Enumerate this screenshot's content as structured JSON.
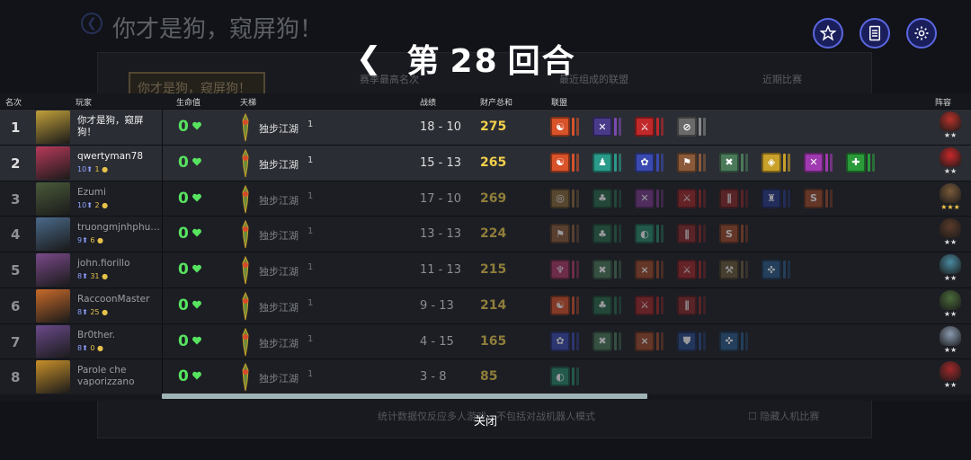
{
  "background": {
    "title": "你才是狗，窥屏狗！",
    "frame_text": "你才是狗，窥屏狗！",
    "tabs": [
      "赛季最高名次",
      "最近组成的联盟",
      "近期比赛"
    ],
    "footer_note": "统计数据仅反应多人游戏，不包括对战机器人模式",
    "footer_checkbox": "隐藏人机比赛"
  },
  "header": {
    "round_prefix": "第",
    "round_number": "28",
    "round_suffix": "回合",
    "back_icon": "chevron-left-icon"
  },
  "top_buttons": [
    {
      "icon": "star-icon"
    },
    {
      "icon": "document-icon"
    },
    {
      "icon": "gear-icon"
    }
  ],
  "columns": {
    "rank": "名次",
    "player": "玩家",
    "health": "生命值",
    "ladder": "天梯",
    "record": "战绩",
    "wealth": "财产总和",
    "alliances": "联盟",
    "lineup": "阵容"
  },
  "players": [
    {
      "rank": "1",
      "name": "你才是狗，窥屏狗！",
      "stats_a": "",
      "stats_b": "",
      "hp": "0",
      "ladder": "独步江湖",
      "ladder_rank": "1",
      "record": "18 - 10",
      "wealth": "275",
      "avatar_color": "#c2a03a",
      "lineup_color": "#b8322a",
      "stars": "★★",
      "alliances": [
        {
          "color": "#d8522a",
          "glyph": "☯",
          "bar": "#d8522a"
        },
        {
          "color": "#4a3a8a",
          "glyph": "✕",
          "bar": "#7a4ab0"
        },
        {
          "color": "#c0282a",
          "glyph": "⚔",
          "bar": "#c0282a"
        },
        {
          "color": "#6a6a6a",
          "glyph": "⊘",
          "bar": "#888888"
        }
      ]
    },
    {
      "rank": "2",
      "name": "qwertyman78",
      "stats_a": "10",
      "stats_b": "1",
      "hp": "0",
      "ladder": "独步江湖",
      "ladder_rank": "1",
      "record": "15 - 13",
      "wealth": "265",
      "avatar_color": "#b83a5a",
      "lineup_color": "#c8282a",
      "stars": "★★",
      "alliances": [
        {
          "color": "#d8522a",
          "glyph": "☯",
          "bar": "#d8522a"
        },
        {
          "color": "#2a9a8a",
          "glyph": "♟",
          "bar": "#2a9a8a"
        },
        {
          "color": "#3a4ab0",
          "glyph": "✿",
          "bar": "#3a4ab0"
        },
        {
          "color": "#8a5a3a",
          "glyph": "⚑",
          "bar": "#8a5a3a"
        },
        {
          "color": "#4a7a5a",
          "glyph": "✖",
          "bar": "#4a7a5a"
        },
        {
          "color": "#c8a02a",
          "glyph": "◈",
          "bar": "#c8a02a"
        },
        {
          "color": "#a03ab0",
          "glyph": "✕",
          "bar": "#a03ab0"
        },
        {
          "color": "#2a9a3a",
          "glyph": "✚",
          "bar": "#2a9a3a"
        }
      ]
    },
    {
      "rank": "3",
      "name": "Ezumi",
      "stats_a": "10",
      "stats_b": "2",
      "hp": "0",
      "ladder": "独步江湖",
      "ladder_rank": "1",
      "record": "17 - 10",
      "wealth": "269",
      "avatar_color": "#4a5a3a",
      "lineup_color": "#7a5a3a",
      "stars": "★★★",
      "alliances": [
        {
          "color": "#8a6a3a",
          "glyph": "◎",
          "bar": "#8a6a3a"
        },
        {
          "color": "#2a6a4a",
          "glyph": "♣",
          "bar": "#2a6a4a"
        },
        {
          "color": "#7a3a8a",
          "glyph": "✕",
          "bar": "#7a3a8a"
        },
        {
          "color": "#a0282a",
          "glyph": "⚔",
          "bar": "#a0282a"
        },
        {
          "color": "#8a2a2a",
          "glyph": "∥",
          "bar": "#8a2a2a"
        },
        {
          "color": "#2a3a8a",
          "glyph": "♜",
          "bar": "#2a3a8a"
        },
        {
          "color": "#a04a2a",
          "glyph": "S",
          "bar": "#a04a2a"
        }
      ]
    },
    {
      "rank": "4",
      "name": "truongmjnhphu…",
      "stats_a": "9",
      "stats_b": "6",
      "hp": "0",
      "ladder": "独步江湖",
      "ladder_rank": "1",
      "record": "13 - 13",
      "wealth": "224",
      "avatar_color": "#4a6a8a",
      "lineup_color": "#5a3a2a",
      "stars": "★★",
      "alliances": [
        {
          "color": "#8a5a3a",
          "glyph": "⚑",
          "bar": "#8a5a3a"
        },
        {
          "color": "#2a6a4a",
          "glyph": "♣",
          "bar": "#2a6a4a"
        },
        {
          "color": "#2a8a6a",
          "glyph": "◐",
          "bar": "#2a8a6a"
        },
        {
          "color": "#8a2a2a",
          "glyph": "∥",
          "bar": "#8a2a2a"
        },
        {
          "color": "#a04a2a",
          "glyph": "S",
          "bar": "#a04a2a"
        }
      ]
    },
    {
      "rank": "5",
      "name": "john.fiorillo",
      "stats_a": "8",
      "stats_b": "31",
      "hp": "0",
      "ladder": "独步江湖",
      "ladder_rank": "1",
      "record": "11 - 13",
      "wealth": "215",
      "avatar_color": "#7a4a8a",
      "lineup_color": "#4a8aa0",
      "stars": "★★",
      "alliances": [
        {
          "color": "#b03a6a",
          "glyph": "♆",
          "bar": "#b03a6a"
        },
        {
          "color": "#4a7a5a",
          "glyph": "✖",
          "bar": "#4a7a5a"
        },
        {
          "color": "#a04a2a",
          "glyph": "⨯",
          "bar": "#a04a2a"
        },
        {
          "color": "#a0282a",
          "glyph": "⚔",
          "bar": "#a0282a"
        },
        {
          "color": "#6a5a3a",
          "glyph": "⚒",
          "bar": "#6a5a3a"
        },
        {
          "color": "#2a5a8a",
          "glyph": "✜",
          "bar": "#2a5a8a"
        }
      ]
    },
    {
      "rank": "6",
      "name": "RaccoonMaster",
      "stats_a": "8",
      "stats_b": "25",
      "hp": "0",
      "ladder": "独步江湖",
      "ladder_rank": "1",
      "record": "9 - 13",
      "wealth": "214",
      "avatar_color": "#c86a2a",
      "lineup_color": "#4a6a3a",
      "stars": "★★",
      "alliances": [
        {
          "color": "#d8522a",
          "glyph": "☯",
          "bar": "#d8522a"
        },
        {
          "color": "#2a6a4a",
          "glyph": "♣",
          "bar": "#2a6a4a"
        },
        {
          "color": "#a0282a",
          "glyph": "⚔",
          "bar": "#a0282a"
        },
        {
          "color": "#8a2a2a",
          "glyph": "∥",
          "bar": "#8a2a2a"
        }
      ]
    },
    {
      "rank": "7",
      "name": "Br0ther.",
      "stats_a": "8",
      "stats_b": "0",
      "hp": "0",
      "ladder": "独步江湖",
      "ladder_rank": "1",
      "record": "4 - 15",
      "wealth": "165",
      "avatar_color": "#6a4a8a",
      "lineup_color": "#8a9ab0",
      "stars": "★★",
      "alliances": [
        {
          "color": "#3a4ab0",
          "glyph": "✿",
          "bar": "#3a4ab0"
        },
        {
          "color": "#4a7a5a",
          "glyph": "✖",
          "bar": "#4a7a5a"
        },
        {
          "color": "#a04a2a",
          "glyph": "⨯",
          "bar": "#a04a2a"
        },
        {
          "color": "#2a4a8a",
          "glyph": "⛊",
          "bar": "#2a4a8a"
        },
        {
          "color": "#2a5a8a",
          "glyph": "✜",
          "bar": "#2a5a8a"
        }
      ]
    },
    {
      "rank": "8",
      "name": "Parole che vaporizzano",
      "stats_a": "",
      "stats_b": "",
      "hp": "0",
      "ladder": "独步江湖",
      "ladder_rank": "1",
      "record": "3 - 8",
      "wealth": "85",
      "avatar_color": "#c8902a",
      "lineup_color": "#a0282a",
      "stars": "★★",
      "alliances": [
        {
          "color": "#2a8a6a",
          "glyph": "◐",
          "bar": "#2a8a6a"
        }
      ]
    }
  ],
  "close_label": "关闭"
}
